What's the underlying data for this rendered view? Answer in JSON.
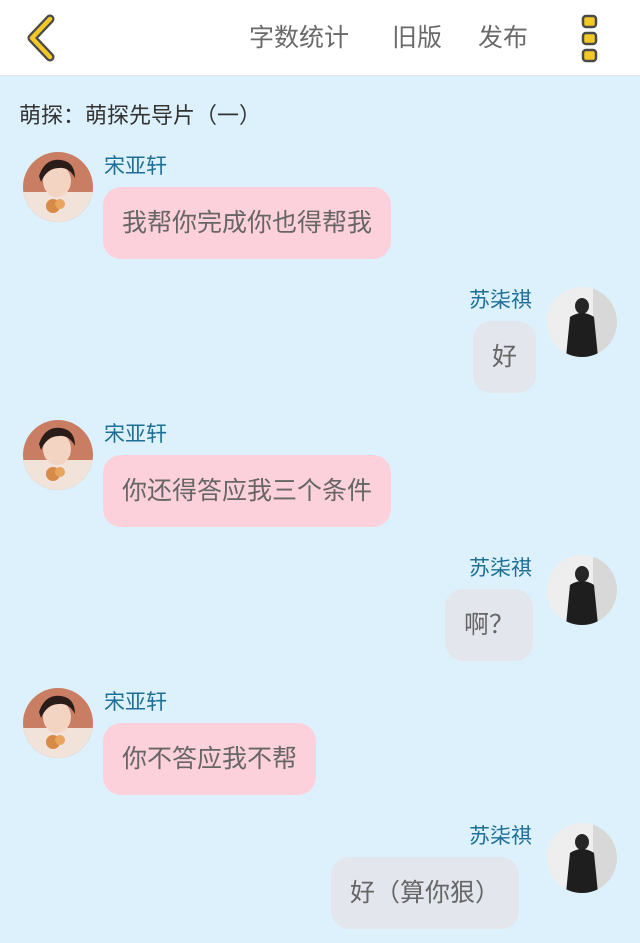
{
  "header": {
    "word_count_label": "字数统计",
    "old_version_label": "旧版",
    "publish_label": "发布"
  },
  "colors": {
    "accent": "#f3c928",
    "left_bubble": "#fdd1db",
    "right_bubble": "#e3e6ec",
    "background": "#ddf1fc",
    "name_text": "#1d6f97"
  },
  "story": {
    "title": "萌探：萌探先导片（一）"
  },
  "messages": [
    {
      "sender": "宋亚轩",
      "side": "left",
      "text": "我帮你完成你也得帮我"
    },
    {
      "sender": "苏柒祺",
      "side": "right",
      "text": "好"
    },
    {
      "sender": "宋亚轩",
      "side": "left",
      "text": "你还得答应我三个条件"
    },
    {
      "sender": "苏柒祺",
      "side": "right",
      "text": "啊？"
    },
    {
      "sender": "宋亚轩",
      "side": "left",
      "text": "你不答应我不帮"
    },
    {
      "sender": "苏柒祺",
      "side": "right",
      "text": "好（算你狠）"
    }
  ]
}
